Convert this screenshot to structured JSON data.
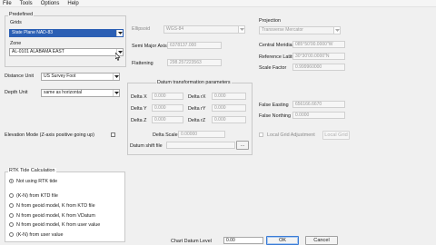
{
  "menu": [
    "File",
    "Tools",
    "Options",
    "Help"
  ],
  "predefined": {
    "legend": "Predefined",
    "grids_label": "Grids",
    "grids_value": "State Plane NAD-83",
    "zone_label": "Zone",
    "zone_value": "AL-0101 ALABAMA EAST"
  },
  "units": {
    "distance_label": "Distance Unit",
    "distance_value": "US Survey Foot",
    "depth_label": "Depth Unit",
    "depth_value": "same as horizontal"
  },
  "elevation_mode_label": "Elevation Mode (Z-axis positive going up)",
  "ellipsoid": {
    "label": "Ellipsoid",
    "value": "WGS-84",
    "semi_major_label": "Semi Major Axis",
    "semi_major_value": "6378137.000",
    "flattening_label": "Flattening",
    "flattening_value": "298.257223563"
  },
  "projection": {
    "label": "Projection",
    "value": "Transverse Mercator",
    "central_meridian_label": "Central Meridian",
    "central_meridian_value": "085°50'00.0000\"W",
    "reference_latitude_label": "Reference Latitude",
    "reference_latitude_value": "30°30'00.0000\"N",
    "scale_factor_label": "Scale Factor",
    "scale_factor_value": "0.999960000",
    "false_easting_label": "False Easting",
    "false_easting_value": "656166.6670",
    "false_northing_label": "False Northing",
    "false_northing_value": "0.0000"
  },
  "datum": {
    "legend": "Datum transformation parameters",
    "delta_x_label": "Delta X",
    "delta_x": "0.000",
    "delta_y_label": "Delta Y",
    "delta_y": "0.000",
    "delta_z_label": "Delta Z",
    "delta_z": "0.000",
    "delta_rx_label": "Delta rX",
    "delta_rx": "0.000",
    "delta_ry_label": "Delta rY",
    "delta_ry": "0.000",
    "delta_rz_label": "Delta rZ",
    "delta_rz": "0.000",
    "scale_label": "Delta Scale",
    "scale": "0.00000",
    "shift_label": "Datum shift file",
    "shift_button": "..."
  },
  "local_grid": {
    "label": "Local Grid Adjustment",
    "button": "Local Grid"
  },
  "rtk": {
    "legend": "RTK Tide Calculation",
    "options": [
      "Not using RTK tide",
      "(K-N) from KTD file",
      "N from geoid model, K from KTD file",
      "N from geoid model, K from VDatum",
      "N from geoid model, K from user value",
      "(K-N) from user value"
    ],
    "selected_index": 0
  },
  "chart_datum": {
    "label": "Chart Datum Level",
    "value": "0.00"
  },
  "buttons": {
    "ok": "OK",
    "cancel": "Cancel"
  }
}
